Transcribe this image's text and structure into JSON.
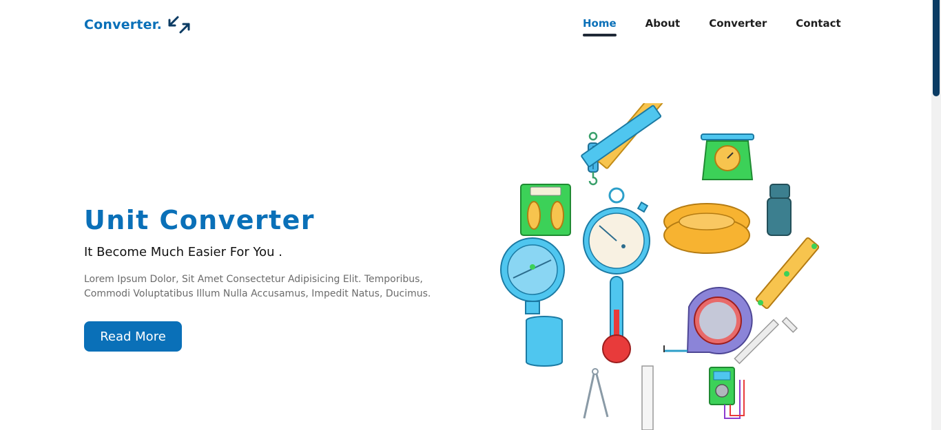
{
  "brand": {
    "name": "Converter.",
    "icon": "arrows-diagonal-icon"
  },
  "nav": {
    "items": [
      {
        "label": "Home",
        "active": true
      },
      {
        "label": "About",
        "active": false
      },
      {
        "label": "Converter",
        "active": false
      },
      {
        "label": "Contact",
        "active": false
      }
    ]
  },
  "hero": {
    "title": "Unit Converter",
    "subtitle": "It Become Much Easier For You .",
    "body": "Lorem Ipsum Dolor, Sit Amet Consectetur Adipisicing Elit. Temporibus, Commodi Voluptatibus Illum Nulla Accusamus, Impedit Natus, Ducimus.",
    "cta_label": "Read More"
  },
  "colors": {
    "accent": "#0a70b8",
    "nav_text": "#1e1e1e",
    "body_text": "#6b6b6b"
  }
}
